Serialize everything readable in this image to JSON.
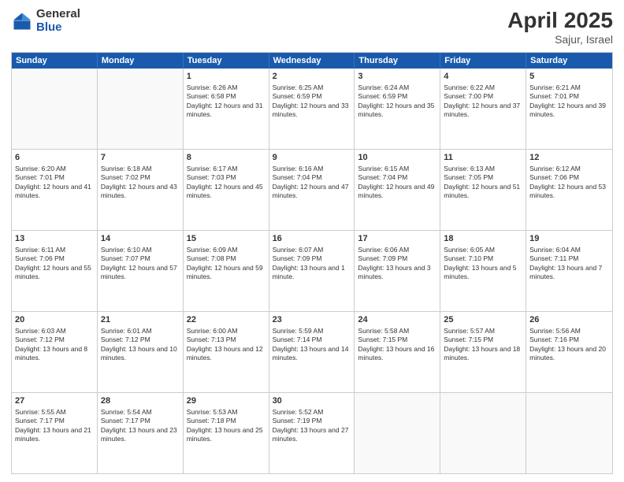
{
  "header": {
    "logo_general": "General",
    "logo_blue": "Blue",
    "month_title": "April 2025",
    "location": "Sajur, Israel"
  },
  "weekdays": [
    "Sunday",
    "Monday",
    "Tuesday",
    "Wednesday",
    "Thursday",
    "Friday",
    "Saturday"
  ],
  "weeks": [
    [
      {
        "day": "",
        "empty": true
      },
      {
        "day": "",
        "empty": true
      },
      {
        "day": "1",
        "sunrise": "Sunrise: 6:26 AM",
        "sunset": "Sunset: 6:58 PM",
        "daylight": "Daylight: 12 hours and 31 minutes."
      },
      {
        "day": "2",
        "sunrise": "Sunrise: 6:25 AM",
        "sunset": "Sunset: 6:59 PM",
        "daylight": "Daylight: 12 hours and 33 minutes."
      },
      {
        "day": "3",
        "sunrise": "Sunrise: 6:24 AM",
        "sunset": "Sunset: 6:59 PM",
        "daylight": "Daylight: 12 hours and 35 minutes."
      },
      {
        "day": "4",
        "sunrise": "Sunrise: 6:22 AM",
        "sunset": "Sunset: 7:00 PM",
        "daylight": "Daylight: 12 hours and 37 minutes."
      },
      {
        "day": "5",
        "sunrise": "Sunrise: 6:21 AM",
        "sunset": "Sunset: 7:01 PM",
        "daylight": "Daylight: 12 hours and 39 minutes."
      }
    ],
    [
      {
        "day": "6",
        "sunrise": "Sunrise: 6:20 AM",
        "sunset": "Sunset: 7:01 PM",
        "daylight": "Daylight: 12 hours and 41 minutes."
      },
      {
        "day": "7",
        "sunrise": "Sunrise: 6:18 AM",
        "sunset": "Sunset: 7:02 PM",
        "daylight": "Daylight: 12 hours and 43 minutes."
      },
      {
        "day": "8",
        "sunrise": "Sunrise: 6:17 AM",
        "sunset": "Sunset: 7:03 PM",
        "daylight": "Daylight: 12 hours and 45 minutes."
      },
      {
        "day": "9",
        "sunrise": "Sunrise: 6:16 AM",
        "sunset": "Sunset: 7:04 PM",
        "daylight": "Daylight: 12 hours and 47 minutes."
      },
      {
        "day": "10",
        "sunrise": "Sunrise: 6:15 AM",
        "sunset": "Sunset: 7:04 PM",
        "daylight": "Daylight: 12 hours and 49 minutes."
      },
      {
        "day": "11",
        "sunrise": "Sunrise: 6:13 AM",
        "sunset": "Sunset: 7:05 PM",
        "daylight": "Daylight: 12 hours and 51 minutes."
      },
      {
        "day": "12",
        "sunrise": "Sunrise: 6:12 AM",
        "sunset": "Sunset: 7:06 PM",
        "daylight": "Daylight: 12 hours and 53 minutes."
      }
    ],
    [
      {
        "day": "13",
        "sunrise": "Sunrise: 6:11 AM",
        "sunset": "Sunset: 7:06 PM",
        "daylight": "Daylight: 12 hours and 55 minutes."
      },
      {
        "day": "14",
        "sunrise": "Sunrise: 6:10 AM",
        "sunset": "Sunset: 7:07 PM",
        "daylight": "Daylight: 12 hours and 57 minutes."
      },
      {
        "day": "15",
        "sunrise": "Sunrise: 6:09 AM",
        "sunset": "Sunset: 7:08 PM",
        "daylight": "Daylight: 12 hours and 59 minutes."
      },
      {
        "day": "16",
        "sunrise": "Sunrise: 6:07 AM",
        "sunset": "Sunset: 7:09 PM",
        "daylight": "Daylight: 13 hours and 1 minute."
      },
      {
        "day": "17",
        "sunrise": "Sunrise: 6:06 AM",
        "sunset": "Sunset: 7:09 PM",
        "daylight": "Daylight: 13 hours and 3 minutes."
      },
      {
        "day": "18",
        "sunrise": "Sunrise: 6:05 AM",
        "sunset": "Sunset: 7:10 PM",
        "daylight": "Daylight: 13 hours and 5 minutes."
      },
      {
        "day": "19",
        "sunrise": "Sunrise: 6:04 AM",
        "sunset": "Sunset: 7:11 PM",
        "daylight": "Daylight: 13 hours and 7 minutes."
      }
    ],
    [
      {
        "day": "20",
        "sunrise": "Sunrise: 6:03 AM",
        "sunset": "Sunset: 7:12 PM",
        "daylight": "Daylight: 13 hours and 8 minutes."
      },
      {
        "day": "21",
        "sunrise": "Sunrise: 6:01 AM",
        "sunset": "Sunset: 7:12 PM",
        "daylight": "Daylight: 13 hours and 10 minutes."
      },
      {
        "day": "22",
        "sunrise": "Sunrise: 6:00 AM",
        "sunset": "Sunset: 7:13 PM",
        "daylight": "Daylight: 13 hours and 12 minutes."
      },
      {
        "day": "23",
        "sunrise": "Sunrise: 5:59 AM",
        "sunset": "Sunset: 7:14 PM",
        "daylight": "Daylight: 13 hours and 14 minutes."
      },
      {
        "day": "24",
        "sunrise": "Sunrise: 5:58 AM",
        "sunset": "Sunset: 7:15 PM",
        "daylight": "Daylight: 13 hours and 16 minutes."
      },
      {
        "day": "25",
        "sunrise": "Sunrise: 5:57 AM",
        "sunset": "Sunset: 7:15 PM",
        "daylight": "Daylight: 13 hours and 18 minutes."
      },
      {
        "day": "26",
        "sunrise": "Sunrise: 5:56 AM",
        "sunset": "Sunset: 7:16 PM",
        "daylight": "Daylight: 13 hours and 20 minutes."
      }
    ],
    [
      {
        "day": "27",
        "sunrise": "Sunrise: 5:55 AM",
        "sunset": "Sunset: 7:17 PM",
        "daylight": "Daylight: 13 hours and 21 minutes."
      },
      {
        "day": "28",
        "sunrise": "Sunrise: 5:54 AM",
        "sunset": "Sunset: 7:17 PM",
        "daylight": "Daylight: 13 hours and 23 minutes."
      },
      {
        "day": "29",
        "sunrise": "Sunrise: 5:53 AM",
        "sunset": "Sunset: 7:18 PM",
        "daylight": "Daylight: 13 hours and 25 minutes."
      },
      {
        "day": "30",
        "sunrise": "Sunrise: 5:52 AM",
        "sunset": "Sunset: 7:19 PM",
        "daylight": "Daylight: 13 hours and 27 minutes."
      },
      {
        "day": "",
        "empty": true
      },
      {
        "day": "",
        "empty": true
      },
      {
        "day": "",
        "empty": true
      }
    ]
  ]
}
